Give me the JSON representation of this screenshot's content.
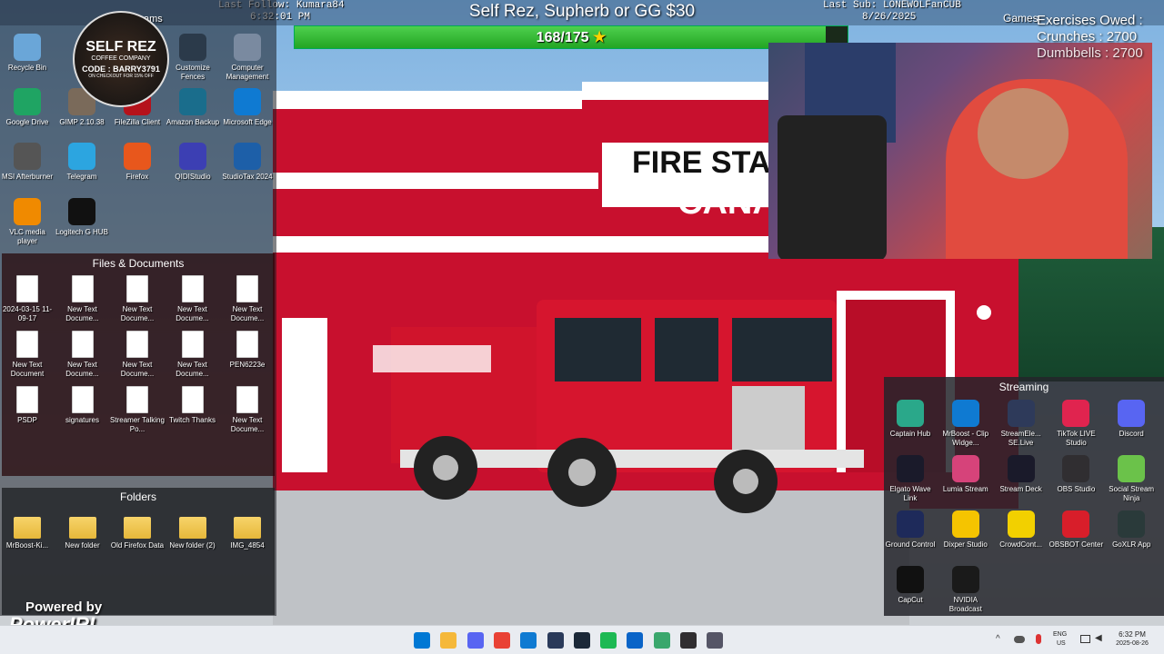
{
  "stream": {
    "last_follow": "Last Follow: Kumara84",
    "time_top": "6:32:01 PM",
    "banner": "Self Rez, Supherb or GG $30",
    "last_sub": "Last Sub: LONEWOLFanCUB",
    "date_top": "8/26/2025",
    "games_label": "Games",
    "left_partial": "ams",
    "progress_text": "168/175",
    "progress_value": 168,
    "progress_max": 175,
    "exercises_title": "Exercises Owed :",
    "crunches": "Crunches : 2700",
    "dumbbells": "Dumbbells : 2700",
    "powered_by": "Powered by",
    "powerirl": "PowerIRL"
  },
  "logo": {
    "name": "SELF REZ",
    "sub": "COFFEE COMPANY",
    "code": "CODE : BARRY3791",
    "tag": "ON CHECKOUT FOR 15% OFF"
  },
  "desktop_icons": [
    {
      "label": "Recycle Bin",
      "icon": "recycle-bin-icon",
      "color": "#6aa6d8"
    },
    {
      "label": "Google Drive",
      "icon": "google-drive-icon",
      "color": "#1fa463"
    },
    {
      "label": "GIMP 2.10.38",
      "icon": "gimp-icon",
      "color": "#7a6a5a"
    },
    {
      "label": "FileZilla Client",
      "icon": "filezilla-icon",
      "color": "#b5121b"
    },
    {
      "label": "Customize Fences",
      "icon": "fences-icon",
      "color": "#2b3a4a"
    },
    {
      "label": "Computer Management",
      "icon": "computer-management-icon",
      "color": "#7a8aa0"
    },
    {
      "label": "Amazon Backup",
      "icon": "amazon-photos-icon",
      "color": "#1a6d8c"
    },
    {
      "label": "Microsoft Edge",
      "icon": "edge-icon",
      "color": "#0f7ad2"
    },
    {
      "label": "MSI Afterburner",
      "icon": "msi-afterburner-icon",
      "color": "#555"
    },
    {
      "label": "Telegram",
      "icon": "telegram-icon",
      "color": "#2ca5e0"
    },
    {
      "label": "Firefox",
      "icon": "firefox-icon",
      "color": "#e8571c"
    },
    {
      "label": "QIDIStudio",
      "icon": "qidistudio-icon",
      "color": "#3c3fb3"
    },
    {
      "label": "StudioTax 2024",
      "icon": "studiotax-icon",
      "color": "#1d5fa8"
    },
    {
      "label": "VLC media player",
      "icon": "vlc-icon",
      "color": "#f08a00"
    },
    {
      "label": "Logitech G HUB",
      "icon": "logitech-ghub-icon",
      "color": "#111"
    }
  ],
  "files_title": "Files & Documents",
  "files": [
    {
      "label": "2024-03-15 11-09-17"
    },
    {
      "label": "New Text Docume..."
    },
    {
      "label": "New Text Docume..."
    },
    {
      "label": "New Text Docume..."
    },
    {
      "label": "New Text Docume..."
    },
    {
      "label": "New Text Document"
    },
    {
      "label": "New Text Docume..."
    },
    {
      "label": "New Text Docume..."
    },
    {
      "label": "New Text Docume..."
    },
    {
      "label": "PEN6223e"
    },
    {
      "label": "PSDP"
    },
    {
      "label": "signatures"
    },
    {
      "label": "Streamer Talking Po..."
    },
    {
      "label": "Twitch Thanks"
    },
    {
      "label": "New Text Docume..."
    }
  ],
  "folders_title": "Folders",
  "folders": [
    {
      "label": "MrBoost-Ki..."
    },
    {
      "label": "New folder"
    },
    {
      "label": "Old Firefox Data"
    },
    {
      "label": "New folder (2)"
    },
    {
      "label": "IMG_4854"
    }
  ],
  "streaming_title": "Streaming",
  "streaming_icons": [
    {
      "label": "Captain Hub",
      "icon": "captain-hub-icon",
      "color": "#2aa88a"
    },
    {
      "label": "MrBoost - Clip Widge...",
      "icon": "mrboost-icon",
      "color": "#0f7ad2"
    },
    {
      "label": "StreamEle... SE.Live",
      "icon": "streamelements-icon",
      "color": "#2e3a5a"
    },
    {
      "label": "TikTok LIVE Studio",
      "icon": "tiktok-icon",
      "color": "#e0244f"
    },
    {
      "label": "Discord",
      "icon": "discord-icon",
      "color": "#5865f2"
    },
    {
      "label": "Elgato Wave Link",
      "icon": "wave-link-icon",
      "color": "#1a1a2a"
    },
    {
      "label": "Lumia Stream",
      "icon": "lumia-icon",
      "color": "#d6437a"
    },
    {
      "label": "Stream Deck",
      "icon": "stream-deck-icon",
      "color": "#1a1a2a"
    },
    {
      "label": "OBS Studio",
      "icon": "obs-icon",
      "color": "#302e31"
    },
    {
      "label": "Social Stream Ninja",
      "icon": "social-stream-icon",
      "color": "#6bc24a"
    },
    {
      "label": "Ground Control",
      "icon": "ground-control-icon",
      "color": "#1e2a5a"
    },
    {
      "label": "Dixper Studio",
      "icon": "dixper-icon",
      "color": "#f5c400"
    },
    {
      "label": "CrowdCont...",
      "icon": "crowd-control-icon",
      "color": "#f2d000"
    },
    {
      "label": "OBSBOT Center",
      "icon": "obsbot-icon",
      "color": "#d81e2a"
    },
    {
      "label": "GoXLR App",
      "icon": "goxlr-icon",
      "color": "#2a3a3a"
    },
    {
      "label": "CapCut",
      "icon": "capcut-icon",
      "color": "#111"
    },
    {
      "label": "NVIDIA Broadcast",
      "icon": "nvidia-icon",
      "color": "#1a1a1a"
    }
  ],
  "building_sign": {
    "line1": "FIRE STA",
    "line2": "CANA"
  },
  "taskbar": {
    "icons": [
      {
        "name": "start-button-icon",
        "color": "#0078d4"
      },
      {
        "name": "file-explorer-icon",
        "color": "#f5b83a"
      },
      {
        "name": "discord-taskbar-icon",
        "color": "#5865f2"
      },
      {
        "name": "chrome-icon",
        "color": "#e94235"
      },
      {
        "name": "edge-taskbar-icon",
        "color": "#0f7ad2"
      },
      {
        "name": "app-taskbar-icon",
        "color": "#2a3a5a"
      },
      {
        "name": "steam-icon",
        "color": "#1b2838"
      },
      {
        "name": "spotify-icon",
        "color": "#1db954"
      },
      {
        "name": "outlook-icon",
        "color": "#0a64c8"
      },
      {
        "name": "app2-taskbar-icon",
        "color": "#3aa76d"
      },
      {
        "name": "obs-taskbar-icon",
        "color": "#302e31"
      },
      {
        "name": "settings-icon",
        "color": "#556"
      }
    ],
    "lang": "ENG",
    "region": "US",
    "clock_time": "6:32 PM",
    "clock_date": "2025-08-26"
  }
}
